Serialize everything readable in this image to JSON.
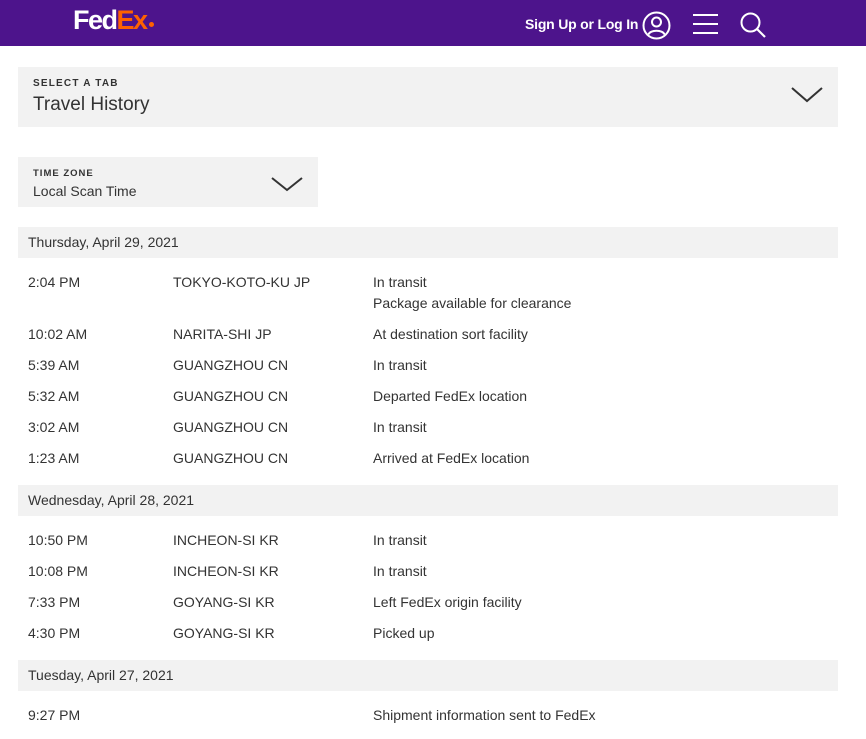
{
  "header": {
    "logo_fed": "Fed",
    "logo_ex": "Ex",
    "signin_label": "Sign Up or Log In",
    "brand_colors": {
      "purple": "#4d148c",
      "orange": "#ff6200"
    },
    "icons": [
      "user-icon",
      "menu-icon",
      "search-icon"
    ]
  },
  "tab_select": {
    "label": "SELECT A TAB",
    "value": "Travel History"
  },
  "timezone_select": {
    "label": "TIME ZONE",
    "value": "Local Scan Time"
  },
  "history": [
    {
      "date": "Thursday, April 29, 2021",
      "events": [
        {
          "time": "2:04 PM",
          "location": "TOKYO-KOTO-KU JP",
          "status": "In transit",
          "detail": "Package available for clearance"
        },
        {
          "time": "10:02 AM",
          "location": "NARITA-SHI JP",
          "status": "At destination sort facility"
        },
        {
          "time": "5:39 AM",
          "location": "GUANGZHOU CN",
          "status": "In transit"
        },
        {
          "time": "5:32 AM",
          "location": "GUANGZHOU CN",
          "status": "Departed FedEx location"
        },
        {
          "time": "3:02 AM",
          "location": "GUANGZHOU CN",
          "status": "In transit"
        },
        {
          "time": "1:23 AM",
          "location": "GUANGZHOU CN",
          "status": "Arrived at FedEx location"
        }
      ]
    },
    {
      "date": "Wednesday, April 28, 2021",
      "events": [
        {
          "time": "10:50 PM",
          "location": "INCHEON-SI KR",
          "status": "In transit"
        },
        {
          "time": "10:08 PM",
          "location": "INCHEON-SI KR",
          "status": "In transit"
        },
        {
          "time": "7:33 PM",
          "location": "GOYANG-SI KR",
          "status": "Left FedEx origin facility"
        },
        {
          "time": "4:30 PM",
          "location": "GOYANG-SI KR",
          "status": "Picked up"
        }
      ]
    },
    {
      "date": "Tuesday, April 27, 2021",
      "events": [
        {
          "time": "9:27 PM",
          "location": "",
          "status": "Shipment information sent to FedEx"
        }
      ]
    }
  ]
}
